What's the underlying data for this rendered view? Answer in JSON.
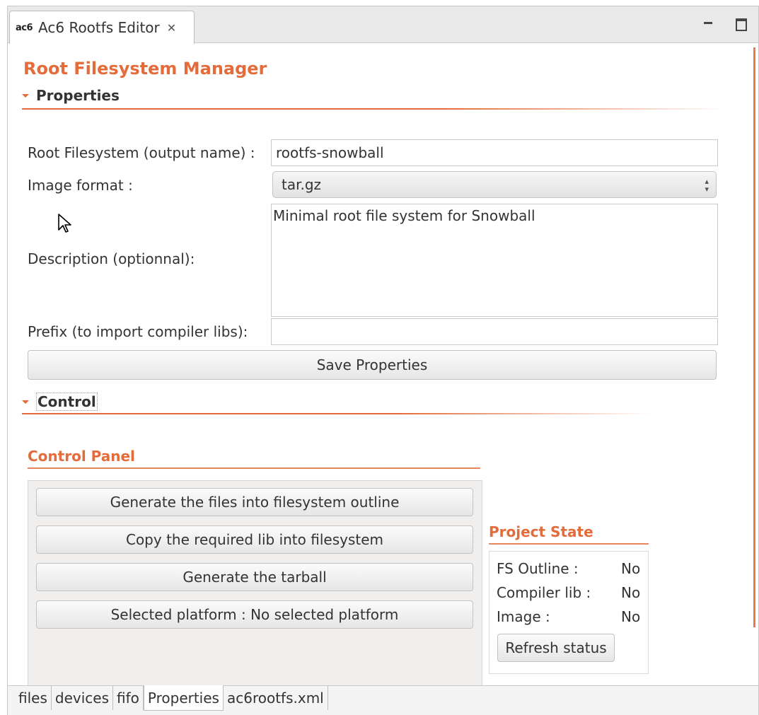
{
  "editor_tab": {
    "logo": "ac6",
    "title": "Ac6 Rootfs Editor",
    "close_glyph": "✕"
  },
  "page_title": "Root Filesystem Manager",
  "properties": {
    "header": "Properties",
    "output_name_label": "Root Filesystem (output name) :",
    "output_name_value": "rootfs-snowball",
    "image_format_label": "Image format :",
    "image_format_value": "tar.gz",
    "description_label": "Description (optionnal):",
    "description_value": "Minimal root file system for Snowball",
    "prefix_label": "Prefix (to import compiler libs):",
    "prefix_value": "",
    "save_button": "Save Properties"
  },
  "control": {
    "header": "Control",
    "panel_title": "Control Panel",
    "buttons": [
      "Generate the files into filesystem outline",
      "Copy the required lib into filesystem",
      "Generate the tarball",
      "Selected platform : No selected platform"
    ]
  },
  "project_state": {
    "title": "Project State",
    "rows": [
      {
        "label": "FS Outline :",
        "value": "No"
      },
      {
        "label": "Compiler lib :",
        "value": "No"
      },
      {
        "label": "Image :",
        "value": "No"
      }
    ],
    "refresh_button": "Refresh status"
  },
  "bottom_tabs": [
    {
      "label": "files",
      "active": false
    },
    {
      "label": "devices",
      "active": false
    },
    {
      "label": "fifo",
      "active": false
    },
    {
      "label": "Properties",
      "active": true
    },
    {
      "label": "ac6rootfs.xml",
      "active": false
    }
  ],
  "colors": {
    "accent": "#e46c3a",
    "panel_bg": "#f0efed"
  }
}
